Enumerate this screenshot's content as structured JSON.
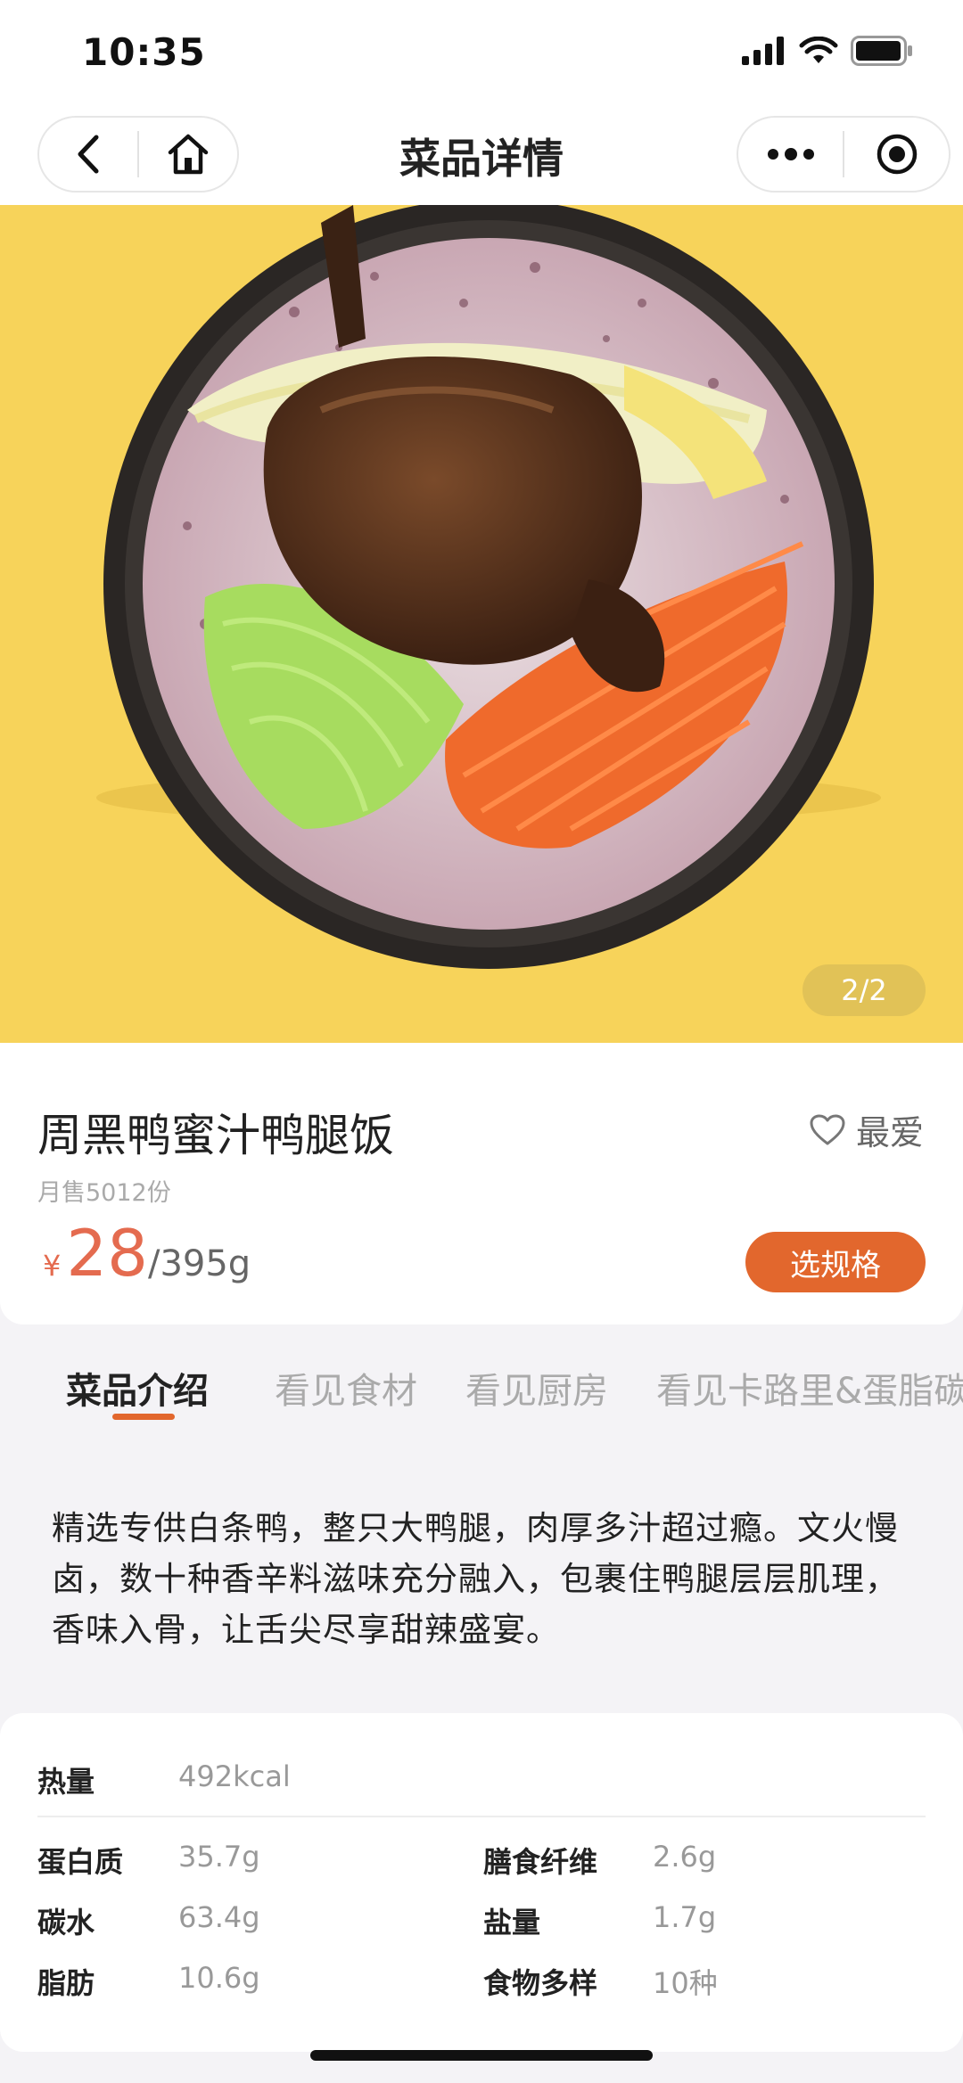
{
  "status_bar": {
    "time": "10:35"
  },
  "nav": {
    "title": "菜品详情"
  },
  "hero": {
    "page_indicator": "2/2"
  },
  "dish": {
    "name": "周黑鸭蜜汁鸭腿饭",
    "favorite_label": "最爱",
    "monthly_sales": "月售5012份",
    "currency": "¥",
    "price": "28",
    "unit": "/395g",
    "spec_button": "选规格"
  },
  "tabs": [
    {
      "label": "菜品介绍",
      "active": true
    },
    {
      "label": "看见食材",
      "active": false
    },
    {
      "label": "看见厨房",
      "active": false
    },
    {
      "label": "看见卡路里&蛋脂碳",
      "active": false
    }
  ],
  "description": "精选专供白条鸭，整只大鸭腿，肉厚多汁超过瘾。文火慢卤，数十种香辛料滋味充分融入，包裹住鸭腿层层肌理，香味入骨，让舌尖尽享甜辣盛宴。",
  "nutrition": {
    "calories": {
      "label": "热量",
      "value": "492kcal"
    },
    "items": [
      {
        "label": "蛋白质",
        "value": "35.7g"
      },
      {
        "label": "膳食纤维",
        "value": "2.6g"
      },
      {
        "label": "碳水",
        "value": "63.4g"
      },
      {
        "label": "盐量",
        "value": "1.7g"
      },
      {
        "label": "脂肪",
        "value": "10.6g"
      },
      {
        "label": "食物多样",
        "value": "10种"
      }
    ]
  },
  "colors": {
    "accent": "#e2672d",
    "price": "#e46b4f",
    "hero_background": "#f7d35a"
  }
}
